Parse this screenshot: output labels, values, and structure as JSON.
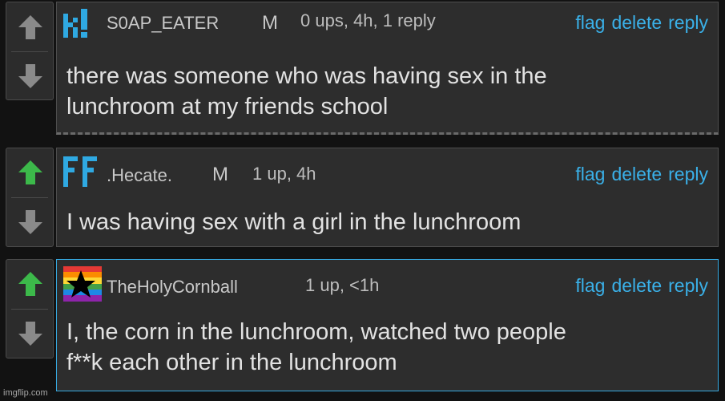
{
  "comments": [
    {
      "username": "S0AP_EATER",
      "gender": "M",
      "meta": "0 ups, 4h, 1 reply",
      "upvoted": false,
      "text_lines": [
        "there was someone who was having sex in the",
        "lunchroom at my friends school"
      ],
      "avatar_icon": "letter-k-exclamation-avatar-icon",
      "actions": {
        "flag": "flag",
        "delete": "delete",
        "reply": "reply"
      }
    },
    {
      "username": ".Hecate.",
      "gender": "M",
      "meta": "1 up, 4h",
      "upvoted": true,
      "text_lines": [
        "I was having sex with a girl in the lunchroom"
      ],
      "avatar_icon": "letters-ff-avatar-icon",
      "actions": {
        "flag": "flag",
        "delete": "delete",
        "reply": "reply"
      }
    },
    {
      "username": "TheHolyCornball",
      "gender": "",
      "meta": "1 up, <1h",
      "upvoted": true,
      "text_lines": [
        "I, the corn in the lunchroom, watched two people",
        "f**k each other in the lunchroom"
      ],
      "avatar_icon": "rainbow-flag-star-avatar-icon",
      "actions": {
        "flag": "flag",
        "delete": "delete",
        "reply": "reply"
      }
    }
  ],
  "colors": {
    "accent": "#3ab0e8",
    "upvote_active": "#3cb94a",
    "arrow_inactive": "#8a8a8a",
    "highlight_border": "#36a9e1"
  },
  "watermark": "imgflip.com"
}
